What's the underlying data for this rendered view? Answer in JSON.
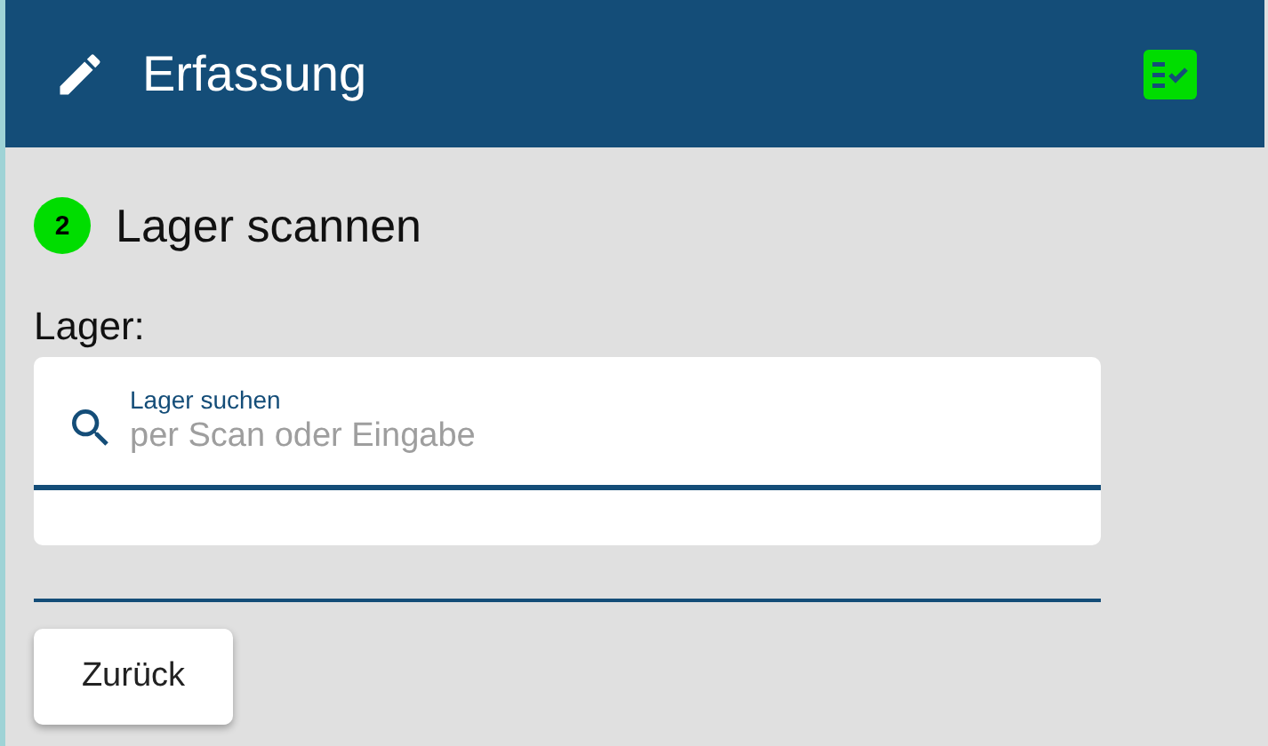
{
  "header": {
    "title": "Erfassung"
  },
  "step": {
    "number": "2",
    "title": "Lager scannen"
  },
  "field_label": "Lager:",
  "search": {
    "label": "Lager suchen",
    "placeholder": "per Scan oder Eingabe"
  },
  "buttons": [
    "Zurück"
  ]
}
